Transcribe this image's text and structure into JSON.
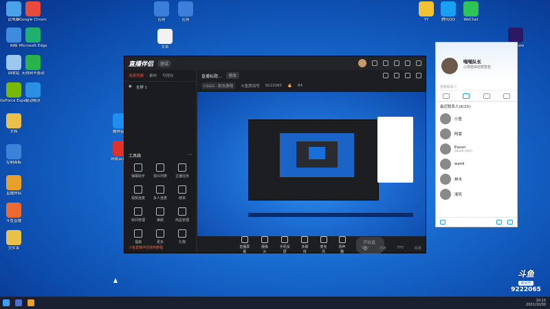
{
  "desktop_icons": [
    {
      "name": "此电脑",
      "icon": "computer-icon",
      "color": "#4aa3e8"
    },
    {
      "name": "Google Chrome",
      "icon": "chrome-icon",
      "color": "#e84b3a"
    },
    {
      "name": "网络",
      "icon": "network-icon",
      "color": "#3f8be0"
    },
    {
      "name": "Microsoft Edge",
      "icon": "edge-icon",
      "color": "#1fb06f"
    },
    {
      "name": "回收站",
      "icon": "recycle-bin-icon",
      "color": "#9cc8f0"
    },
    {
      "name": "无线网卡驱动",
      "icon": "wifi-driver-icon",
      "color": "#29b34a"
    },
    {
      "name": "GeForce Experience",
      "icon": "nvidia-icon",
      "color": "#76b900"
    },
    {
      "name": "驱动精灵",
      "icon": "driver-icon",
      "color": "#2b8fe3"
    },
    {
      "name": "文档",
      "icon": "folder-icon",
      "color": "#e8c04a"
    },
    {
      "name": "控制面板",
      "icon": "control-panel-icon",
      "color": "#3c82d6"
    },
    {
      "name": "直播伴侣",
      "icon": "live-partner-icon",
      "color": "#e8a02a"
    },
    {
      "name": "斗鱼直播",
      "icon": "douyu-icon",
      "color": "#ef6a2f"
    },
    {
      "name": "文件夹",
      "icon": "folder-icon",
      "color": "#e8c04a"
    },
    {
      "name": "酷狗音乐",
      "icon": "kugou-icon",
      "color": "#1f8fef"
    },
    {
      "name": "网易云音乐",
      "icon": "netease-icon",
      "color": "#e0322a"
    },
    {
      "name": "应用",
      "icon": "app-icon",
      "color": "#3b7fd8"
    },
    {
      "name": "应用",
      "icon": "app-icon",
      "color": "#3b7fd8"
    },
    {
      "name": "文本",
      "icon": "text-file-icon",
      "color": "#f2f2f2"
    },
    {
      "name": "YY",
      "icon": "yy-icon",
      "color": "#f1c232"
    },
    {
      "name": "腾讯QQ",
      "icon": "qq-icon",
      "color": "#1aa0f3"
    },
    {
      "name": "WeChat",
      "icon": "wechat-icon",
      "color": "#2ec458"
    },
    {
      "name": "Premiere",
      "icon": "premiere-icon",
      "color": "#2a1a66"
    }
  ],
  "app": {
    "brand": "直播伴侣",
    "version": "测试",
    "left_tabs": [
      "场景搭建",
      "素材",
      "可视化"
    ],
    "scene": "全屏 1",
    "tools_title": "工具箱",
    "tools": [
      "弹幕助手",
      "观众列表",
      "主播任务",
      "视频连麦",
      "多人连麦",
      "榜单",
      "房间管理",
      "美颜",
      "商品管理",
      "福袋",
      "更多",
      "礼物"
    ],
    "left_footer": "斗鱼直播伴侣使用教程",
    "stream_title": "直播标题...",
    "stream_tag": "修改",
    "category": "CSGO · 射击游戏",
    "room_label": "斗鱼房间号",
    "room_id": "9222065",
    "viewers": "84",
    "controls": [
      "直播屏幕",
      "摄像头",
      "手机投屏",
      "多媒体",
      "麦克风",
      "扬声器"
    ],
    "start_button": "开始直播",
    "status": [
      "CPU",
      "内存",
      "FPS",
      "码率"
    ]
  },
  "qq": {
    "nick": "喵喵队长",
    "sign": "心情自由创意签名",
    "search_placeholder": "搜索联系人",
    "group": "最近联系人(8/20)",
    "contacts": [
      {
        "name": "小鱼",
        "sub": ""
      },
      {
        "name": "阿豪",
        "sub": ""
      },
      {
        "name": "Eason",
        "sub": "eason chen"
      },
      {
        "name": "weidi",
        "sub": ""
      },
      {
        "name": "林木",
        "sub": ""
      },
      {
        "name": "清风",
        "sub": ""
      }
    ]
  },
  "taskbar": {
    "time": "10:13",
    "date": "2021/10/30"
  },
  "badge": {
    "logo": "斗鱼",
    "room_text": "房间号",
    "room_id": "9222065"
  }
}
